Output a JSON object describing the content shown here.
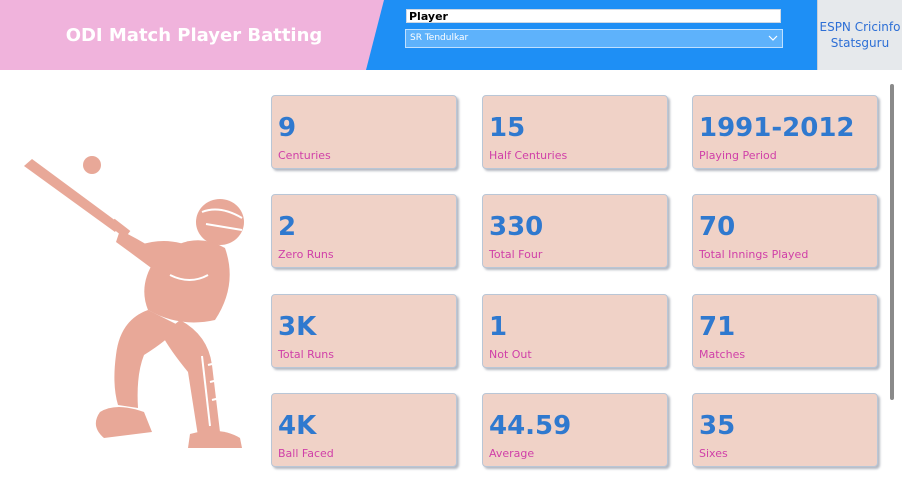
{
  "header": {
    "title": "ODI Match Player Batting",
    "slicer_label": "Player",
    "slicer_value": "SR Tendulkar",
    "link": "ESPN Cricinfo Statsguru"
  },
  "colors": {
    "header_pink": "#f0b3dc",
    "header_blue": "#1e8ff5",
    "card_bg": "#f0d2c7",
    "value_blue": "#2f79cf",
    "label_magenta": "#d040a8",
    "illustration": "#e8a898"
  },
  "icons": {
    "dropdown": "chevron-down-icon",
    "illustration": "cricket-batsman-icon"
  },
  "cards": [
    {
      "value": "9",
      "label": "Centuries"
    },
    {
      "value": "15",
      "label": "Half Centuries"
    },
    {
      "value": "1991-2012",
      "label": "Playing Period"
    },
    {
      "value": "2",
      "label": "Zero Runs"
    },
    {
      "value": "330",
      "label": "Total Four"
    },
    {
      "value": "70",
      "label": "Total Innings Played"
    },
    {
      "value": "3K",
      "label": "Total Runs"
    },
    {
      "value": "1",
      "label": "Not Out"
    },
    {
      "value": "71",
      "label": "Matches"
    },
    {
      "value": "4K",
      "label": "Ball Faced"
    },
    {
      "value": "44.59",
      "label": "Average"
    },
    {
      "value": "35",
      "label": "Sixes"
    }
  ]
}
